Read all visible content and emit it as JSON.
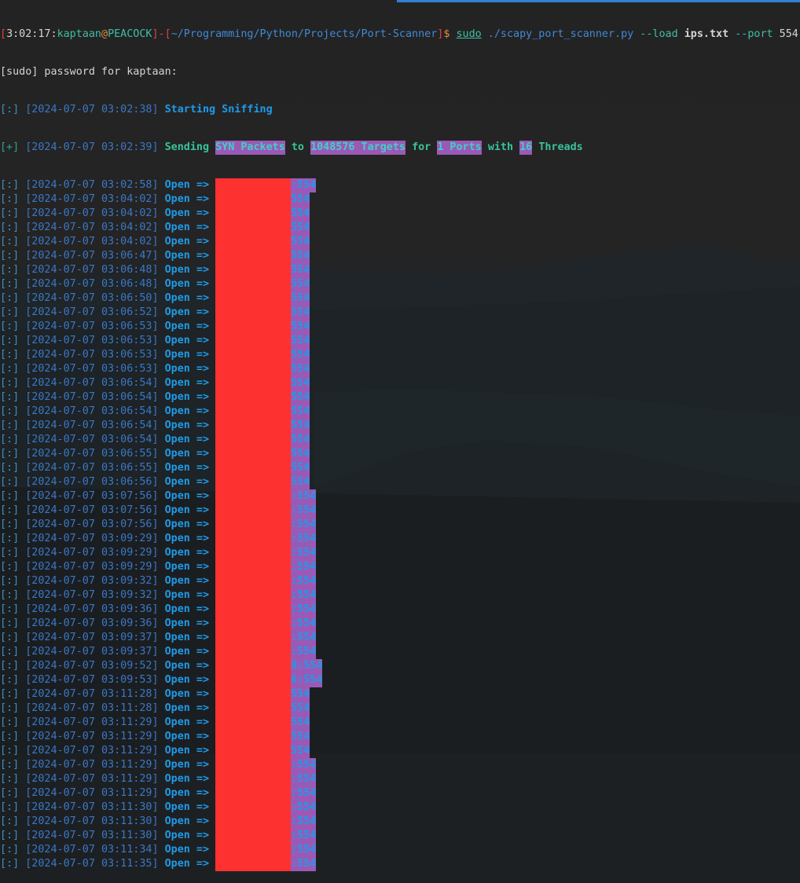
{
  "terminal": {
    "prompt": {
      "time": "3:02:17",
      "user": "kaptaan",
      "at": "@",
      "host": "PEACOCK",
      "path": "~/Programming/Python/Projects/Port-Scanner",
      "dollar": "$",
      "cmd_sudo": "sudo",
      "cmd_script": " ./scapy_port_scanner.py",
      "flag_load": " --load",
      "arg_file": " ips.txt",
      "flag_port": " --port",
      "arg_port": " 554"
    },
    "sudo_prompt": "[sudo] password for kaptaan:",
    "start_line": {
      "tag": "[:]",
      "timestamp": "[2024-07-07 03:02:38]",
      "message": "Starting Sniffing"
    },
    "send_line": {
      "tag": "[+]",
      "timestamp": "[2024-07-07 03:02:39]",
      "w1": "Sending",
      "h1": "SYN Packets",
      "w2": "to",
      "h2": "1048576 Targets",
      "w3": "for",
      "h3": "1 Ports",
      "w4": "with",
      "h4": "16",
      "w5": "Threads"
    },
    "open_label": "Open =>",
    "results": [
      {
        "tag": "[:]",
        "time": "[2024-07-07 03:02:58]",
        "suffix": ":554"
      },
      {
        "tag": "[:]",
        "time": "[2024-07-07 03:04:02]",
        "suffix": "554"
      },
      {
        "tag": "[:]",
        "time": "[2024-07-07 03:04:02]",
        "suffix": "554"
      },
      {
        "tag": "[:]",
        "time": "[2024-07-07 03:04:02]",
        "suffix": "554"
      },
      {
        "tag": "[:]",
        "time": "[2024-07-07 03:04:02]",
        "suffix": "554"
      },
      {
        "tag": "[:]",
        "time": "[2024-07-07 03:06:47]",
        "suffix": "554"
      },
      {
        "tag": "[:]",
        "time": "[2024-07-07 03:06:48]",
        "suffix": "554"
      },
      {
        "tag": "[:]",
        "time": "[2024-07-07 03:06:48]",
        "suffix": "554"
      },
      {
        "tag": "[:]",
        "time": "[2024-07-07 03:06:50]",
        "suffix": "554"
      },
      {
        "tag": "[:]",
        "time": "[2024-07-07 03:06:52]",
        "suffix": "554"
      },
      {
        "tag": "[:]",
        "time": "[2024-07-07 03:06:53]",
        "suffix": "554"
      },
      {
        "tag": "[:]",
        "time": "[2024-07-07 03:06:53]",
        "suffix": "554"
      },
      {
        "tag": "[:]",
        "time": "[2024-07-07 03:06:53]",
        "suffix": "554"
      },
      {
        "tag": "[:]",
        "time": "[2024-07-07 03:06:53]",
        "suffix": "554"
      },
      {
        "tag": "[:]",
        "time": "[2024-07-07 03:06:54]",
        "suffix": "554"
      },
      {
        "tag": "[:]",
        "time": "[2024-07-07 03:06:54]",
        "suffix": "554"
      },
      {
        "tag": "[:]",
        "time": "[2024-07-07 03:06:54]",
        "suffix": "554"
      },
      {
        "tag": "[:]",
        "time": "[2024-07-07 03:06:54]",
        "suffix": "554"
      },
      {
        "tag": "[:]",
        "time": "[2024-07-07 03:06:54]",
        "suffix": "554"
      },
      {
        "tag": "[:]",
        "time": "[2024-07-07 03:06:55]",
        "suffix": "554"
      },
      {
        "tag": "[:]",
        "time": "[2024-07-07 03:06:55]",
        "suffix": "554"
      },
      {
        "tag": "[:]",
        "time": "[2024-07-07 03:06:56]",
        "suffix": "554"
      },
      {
        "tag": "[:]",
        "time": "[2024-07-07 03:07:56]",
        "suffix": ":554"
      },
      {
        "tag": "[:]",
        "time": "[2024-07-07 03:07:56]",
        "suffix": ":554"
      },
      {
        "tag": "[:]",
        "time": "[2024-07-07 03:07:56]",
        "suffix": ":554"
      },
      {
        "tag": "[:]",
        "time": "[2024-07-07 03:09:29]",
        "suffix": ":554"
      },
      {
        "tag": "[:]",
        "time": "[2024-07-07 03:09:29]",
        "suffix": ":554"
      },
      {
        "tag": "[:]",
        "time": "[2024-07-07 03:09:29]",
        "suffix": ":554"
      },
      {
        "tag": "[:]",
        "time": "[2024-07-07 03:09:32]",
        "suffix": ":554"
      },
      {
        "tag": "[:]",
        "time": "[2024-07-07 03:09:32]",
        "suffix": ":554"
      },
      {
        "tag": "[:]",
        "time": "[2024-07-07 03:09:36]",
        "suffix": ":554"
      },
      {
        "tag": "[:]",
        "time": "[2024-07-07 03:09:36]",
        "suffix": ":554"
      },
      {
        "tag": "[:]",
        "time": "[2024-07-07 03:09:37]",
        "suffix": ":554"
      },
      {
        "tag": "[:]",
        "time": "[2024-07-07 03:09:37]",
        "suffix": ":554"
      },
      {
        "tag": "[:]",
        "time": "[2024-07-07 03:09:52]",
        "suffix": "8:554"
      },
      {
        "tag": "[:]",
        "time": "[2024-07-07 03:09:53]",
        "suffix": "6:554"
      },
      {
        "tag": "[:]",
        "time": "[2024-07-07 03:11:28]",
        "suffix": "554"
      },
      {
        "tag": "[:]",
        "time": "[2024-07-07 03:11:28]",
        "suffix": "554"
      },
      {
        "tag": "[:]",
        "time": "[2024-07-07 03:11:29]",
        "suffix": "554"
      },
      {
        "tag": "[:]",
        "time": "[2024-07-07 03:11:29]",
        "suffix": "554"
      },
      {
        "tag": "[:]",
        "time": "[2024-07-07 03:11:29]",
        "suffix": "554"
      },
      {
        "tag": "[:]",
        "time": "[2024-07-07 03:11:29]",
        "suffix": ":554"
      },
      {
        "tag": "[:]",
        "time": "[2024-07-07 03:11:29]",
        "suffix": ":554"
      },
      {
        "tag": "[:]",
        "time": "[2024-07-07 03:11:29]",
        "suffix": ":554"
      },
      {
        "tag": "[:]",
        "time": "[2024-07-07 03:11:30]",
        "suffix": ":554"
      },
      {
        "tag": "[:]",
        "time": "[2024-07-07 03:11:30]",
        "suffix": ":554"
      },
      {
        "tag": "[:]",
        "time": "[2024-07-07 03:11:30]",
        "suffix": ":554"
      },
      {
        "tag": "[:]",
        "time": "[2024-07-07 03:11:34]",
        "suffix": ":554"
      },
      {
        "tag": "[:]",
        "time": "[2024-07-07 03:11:35]",
        "suffix": ":554"
      }
    ]
  },
  "colors": {
    "redaction": "#fe3131",
    "highlight": "#9b59b6",
    "open": "#1e9be8",
    "accent_bar": "#2f7fd6"
  }
}
